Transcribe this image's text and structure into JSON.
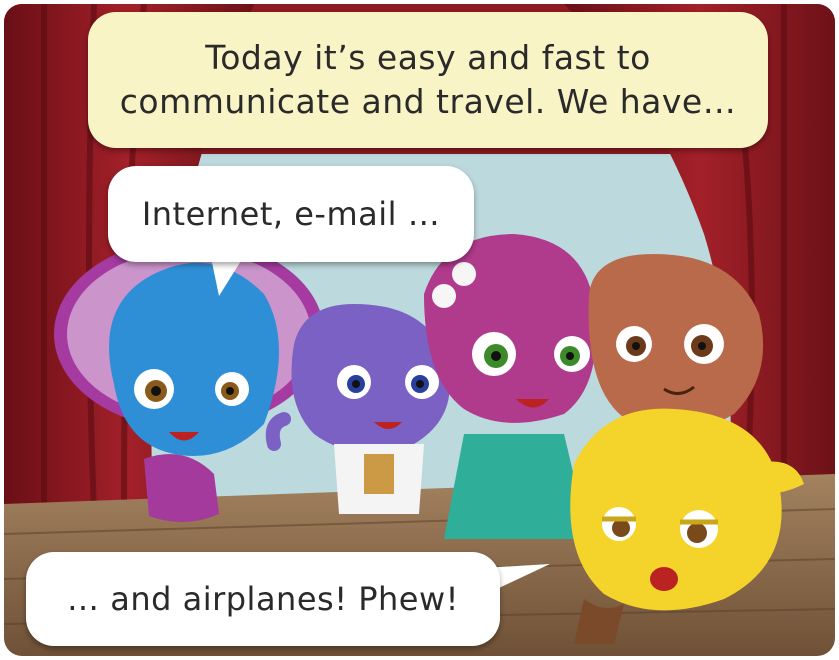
{
  "narration": {
    "line1": "Today it’s easy and fast to",
    "line2": "communicate and travel. We have…"
  },
  "speech_bubble_1": "Internet, e-mail …",
  "speech_bubble_2": "… and airplanes! Phew!",
  "colors": {
    "curtain": "#8e1a22",
    "backdrop": "#bcd9dd",
    "stage_floor": "#8c6e53",
    "narration_bubble": "#f8f4c6",
    "blue_character": "#2f8fd6",
    "purple_character": "#7b61c4",
    "magenta_character": "#b03a8c",
    "brown_character": "#b86a4a",
    "yellow_character": "#f4d42a"
  }
}
